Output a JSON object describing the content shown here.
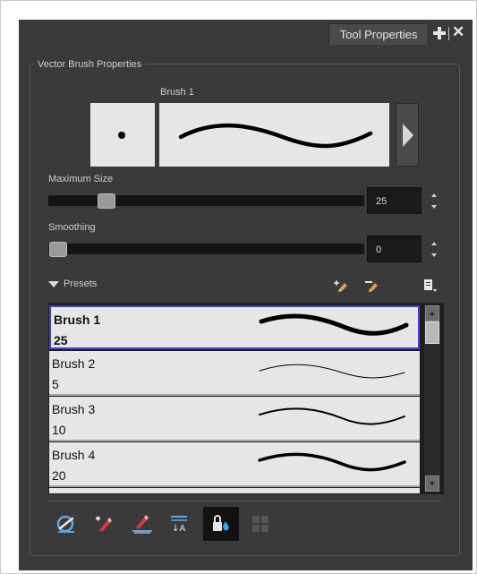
{
  "panel": {
    "tab_label": "Tool Properties",
    "tab_icons": [
      "plus-icon",
      "close-icon"
    ],
    "group_title": "Vector Brush Properties"
  },
  "brush": {
    "name": "Brush 1",
    "tip_icon": "round-tip-icon",
    "maximum_size_label": "Maximum Size",
    "maximum_size_value": "25",
    "maximum_size_slider_fraction": 0.1,
    "smoothing_label": "Smoothing",
    "smoothing_value": "0",
    "smoothing_slider_fraction": 0.0
  },
  "presets": {
    "label": "Presets",
    "header_icons": [
      "new-preset-icon",
      "rename-preset-icon",
      "preset-menu-icon"
    ],
    "items": [
      {
        "name": "Brush 1",
        "size": "25",
        "selected": true
      },
      {
        "name": "Brush 2",
        "size": "5",
        "selected": false
      },
      {
        "name": "Brush 3",
        "size": "10",
        "selected": false
      },
      {
        "name": "Brush 4",
        "size": "20",
        "selected": false
      }
    ]
  },
  "toolbar": {
    "icons": [
      {
        "name": "auto-flatten-icon",
        "active": false
      },
      {
        "name": "draw-behind-icon",
        "active": false
      },
      {
        "name": "auto-create-color-art-icon",
        "active": false
      },
      {
        "name": "auto-fill-icon",
        "active": false
      },
      {
        "name": "lock-colour-icon",
        "active": true
      },
      {
        "name": "texture-grid-icon",
        "active": false
      }
    ]
  },
  "colors": {
    "panel_bg": "#3a3a3a",
    "selection_border": "#3f3fe0",
    "preview_bg": "#e6e6e6"
  }
}
